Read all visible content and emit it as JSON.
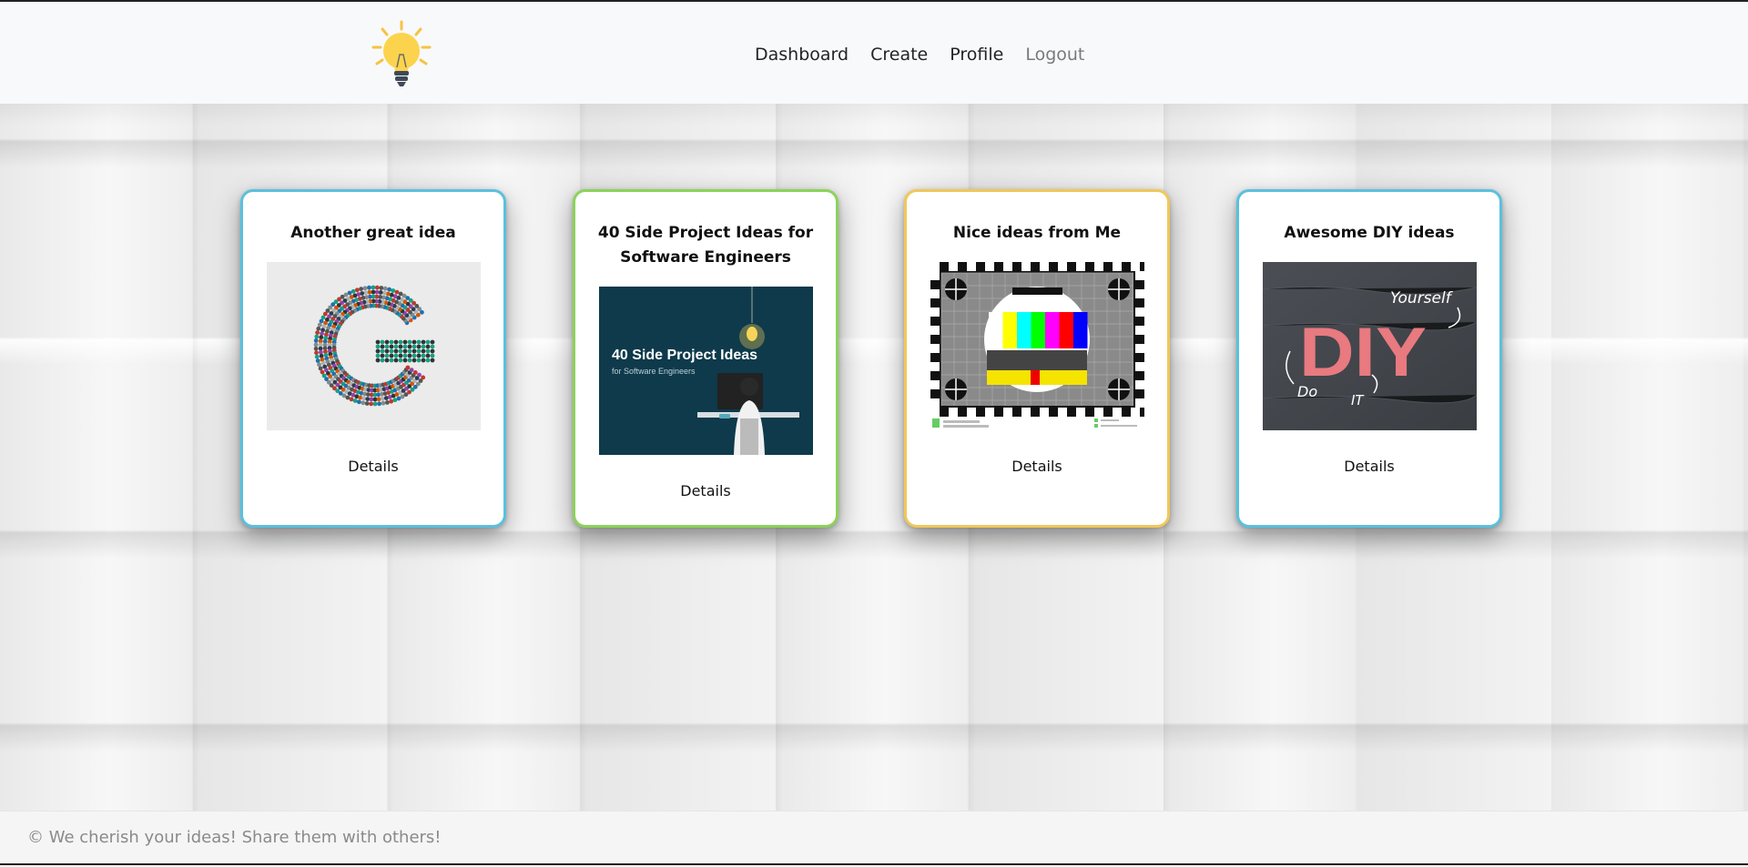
{
  "navbar": {
    "logo_icon": "lightbulb-icon",
    "links": [
      {
        "label": "Dashboard"
      },
      {
        "label": "Create"
      },
      {
        "label": "Profile"
      },
      {
        "label": "Logout"
      }
    ]
  },
  "ideas": [
    {
      "title": "Another great idea",
      "details_label": "Details",
      "border_color": "#5bc0de",
      "image": "crowd-letter-g-image"
    },
    {
      "title": "40 Side Project Ideas for Software Engineers",
      "details_label": "Details",
      "border_color": "#8cd35a",
      "image": "side-project-ideas-image",
      "image_text_main": "40 Side Project Ideas",
      "image_text_sub": "for Software Engineers"
    },
    {
      "title": "Nice ideas from Me",
      "details_label": "Details",
      "border_color": "#f0c85a",
      "image": "tv-test-pattern-image"
    },
    {
      "title": "Awesome DIY ideas",
      "details_label": "Details",
      "border_color": "#5bc0de",
      "image": "diy-letters-image",
      "image_text_main": "DIY",
      "image_text_yourself": "Yourself",
      "image_text_do": "Do",
      "image_text_it": "IT"
    }
  ],
  "footer": {
    "text": "© We cherish your ideas! Share them with others!"
  }
}
